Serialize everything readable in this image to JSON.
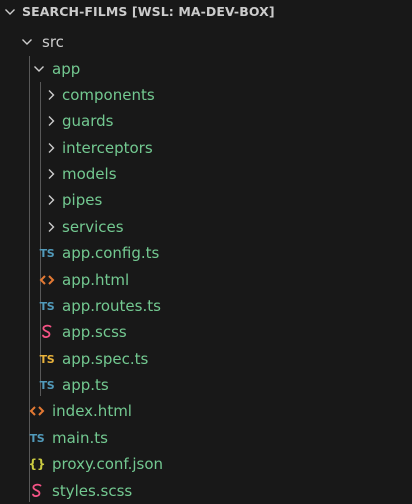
{
  "explorer": {
    "section_title": "SEARCH-FILMS [WSL: MA-DEV-BOX]",
    "tree": {
      "src": {
        "label": "src",
        "expanded": true
      },
      "app": {
        "label": "app",
        "expanded": true
      },
      "folders": [
        {
          "label": "components",
          "expanded": false
        },
        {
          "label": "guards",
          "expanded": false
        },
        {
          "label": "interceptors",
          "expanded": false
        },
        {
          "label": "models",
          "expanded": false
        },
        {
          "label": "pipes",
          "expanded": false
        },
        {
          "label": "services",
          "expanded": false
        }
      ],
      "app_files": [
        {
          "label": "app.config.ts",
          "icon": "TS",
          "type": "typescript-file"
        },
        {
          "label": "app.html",
          "icon": "<>",
          "type": "html-file"
        },
        {
          "label": "app.routes.ts",
          "icon": "TS",
          "type": "typescript-file"
        },
        {
          "label": "app.scss",
          "icon": "sass",
          "type": "scss-file"
        },
        {
          "label": "app.spec.ts",
          "icon": "TS",
          "type": "spec-file"
        },
        {
          "label": "app.ts",
          "icon": "TS",
          "type": "typescript-file"
        }
      ],
      "src_files": [
        {
          "label": "index.html",
          "icon": "<>",
          "type": "html-file"
        },
        {
          "label": "main.ts",
          "icon": "TS",
          "type": "typescript-file"
        },
        {
          "label": "proxy.conf.json",
          "icon": "{}",
          "type": "json-file"
        },
        {
          "label": "styles.scss",
          "icon": "sass",
          "type": "scss-file"
        }
      ]
    },
    "colors": {
      "background": "#181818",
      "text": "#cccccc",
      "untracked_green": "#73c991",
      "ts_blue": "#519aba",
      "spec_orange": "#e8b23b",
      "html_orange": "#e37933",
      "scss_pink": "#f55385",
      "json_yellow": "#cbcb41"
    }
  }
}
